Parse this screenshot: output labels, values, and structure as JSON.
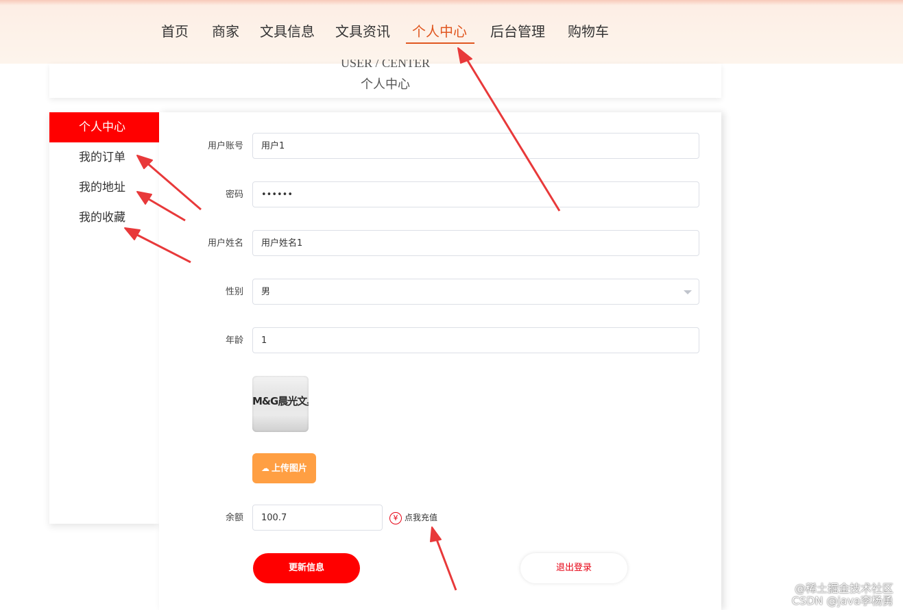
{
  "nav": {
    "items": [
      {
        "label": "首页"
      },
      {
        "label": "商家"
      },
      {
        "label": "文具信息"
      },
      {
        "label": "文具资讯"
      },
      {
        "label": "个人中心",
        "active": true
      },
      {
        "label": "后台管理"
      },
      {
        "label": "购物车"
      }
    ]
  },
  "page_title": {
    "en": "USER / CENTER",
    "cn": "个人中心"
  },
  "sidebar": {
    "items": [
      {
        "label": "个人中心",
        "active": true
      },
      {
        "label": "我的订单"
      },
      {
        "label": "我的地址"
      },
      {
        "label": "我的收藏"
      }
    ]
  },
  "form": {
    "account": {
      "label": "用户账号",
      "value": "用户1"
    },
    "password": {
      "label": "密码",
      "value": "••••••"
    },
    "name": {
      "label": "用户姓名",
      "value": "用户姓名1"
    },
    "gender": {
      "label": "性别",
      "value": "男"
    },
    "age": {
      "label": "年龄",
      "value": "1"
    },
    "avatar": {
      "logo_text": "M&G晨光文具"
    },
    "upload_label": "上传图片",
    "balance": {
      "label": "余额",
      "value": "100.7"
    },
    "recharge_label": "点我充值",
    "recharge_icon": "yen-circle-icon",
    "update_label": "更新信息",
    "logout_label": "退出登录"
  },
  "colors": {
    "accent_red": "#ff0000",
    "nav_active": "#e0561f",
    "upload_orange": "#ff9f43",
    "annotation_arrow": "#e8393a"
  },
  "watermark": {
    "line1": "@稀土掘金技术社区",
    "line2": "CSDN @java李杨勇"
  }
}
